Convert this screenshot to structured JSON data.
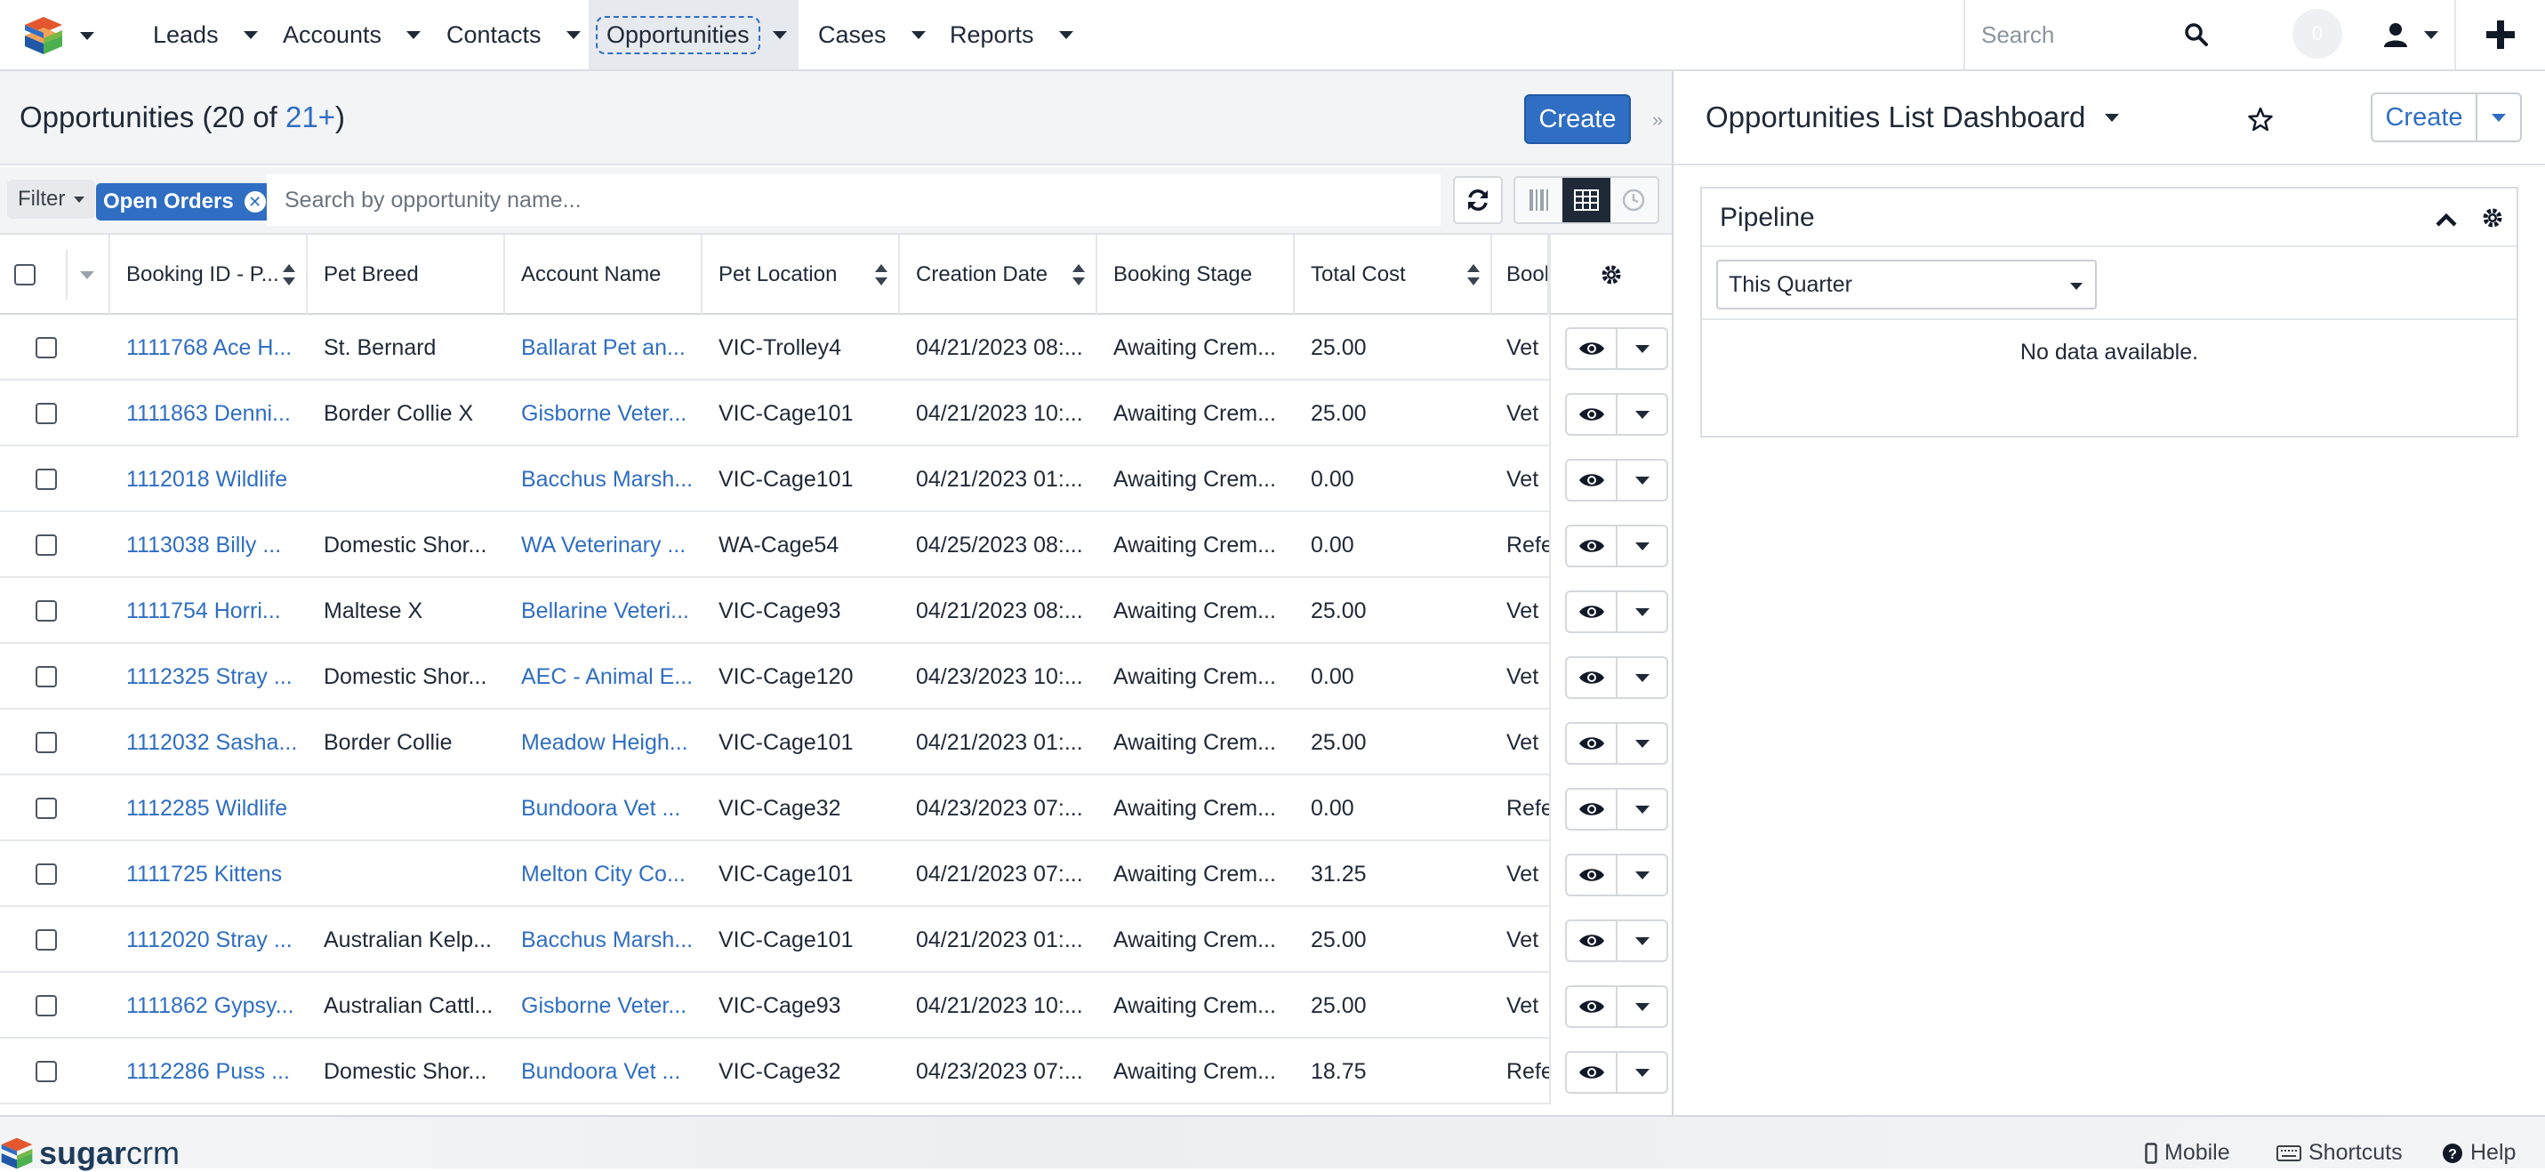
{
  "nav": {
    "items": [
      {
        "label": "Leads"
      },
      {
        "label": "Accounts"
      },
      {
        "label": "Contacts"
      },
      {
        "label": "Opportunities",
        "active": true
      },
      {
        "label": "Cases"
      },
      {
        "label": "Reports"
      }
    ],
    "search_placeholder": "Search",
    "notification_count": "0"
  },
  "list": {
    "title": "Opportunities",
    "count_prefix": "(20 of ",
    "count_total": "21+",
    "count_suffix": ")",
    "create_label": "Create",
    "filter_label": "Filter",
    "active_filter": "Open Orders",
    "search_placeholder": "Search by opportunity name...",
    "columns": [
      {
        "label": "Booking ID - P..."
      },
      {
        "label": "Pet Breed"
      },
      {
        "label": "Account Name"
      },
      {
        "label": "Pet Location"
      },
      {
        "label": "Creation Date"
      },
      {
        "label": "Booking Stage"
      },
      {
        "label": "Total Cost"
      },
      {
        "label": "Bool"
      }
    ],
    "rows": [
      {
        "id": "1111768 Ace H...",
        "breed": "St. Bernard",
        "account": "Ballarat Pet an...",
        "location": "VIC-Trolley4",
        "date": "04/21/2023 08:...",
        "stage": "Awaiting Crem...",
        "cost": "25.00",
        "extra": "Vet"
      },
      {
        "id": "1111863 Denni...",
        "breed": "Border Collie X",
        "account": "Gisborne Veter...",
        "location": "VIC-Cage101",
        "date": "04/21/2023 10:...",
        "stage": "Awaiting Crem...",
        "cost": "25.00",
        "extra": "Vet"
      },
      {
        "id": "1112018 Wildlife",
        "breed": "",
        "account": "Bacchus Marsh...",
        "location": "VIC-Cage101",
        "date": "04/21/2023 01:...",
        "stage": "Awaiting Crem...",
        "cost": "0.00",
        "extra": "Vet"
      },
      {
        "id": "1113038 Billy ...",
        "breed": "Domestic Shor...",
        "account": "WA Veterinary ...",
        "location": "WA-Cage54",
        "date": "04/25/2023 08:...",
        "stage": "Awaiting Crem...",
        "cost": "0.00",
        "extra": "Refe"
      },
      {
        "id": "1111754 Horri...",
        "breed": "Maltese X",
        "account": "Bellarine Veteri...",
        "location": "VIC-Cage93",
        "date": "04/21/2023 08:...",
        "stage": "Awaiting Crem...",
        "cost": "25.00",
        "extra": "Vet"
      },
      {
        "id": "1112325 Stray ...",
        "breed": "Domestic Shor...",
        "account": "AEC - Animal E...",
        "location": "VIC-Cage120",
        "date": "04/23/2023 10:...",
        "stage": "Awaiting Crem...",
        "cost": "0.00",
        "extra": "Vet"
      },
      {
        "id": "1112032 Sasha...",
        "breed": "Border Collie",
        "account": "Meadow Heigh...",
        "location": "VIC-Cage101",
        "date": "04/21/2023 01:...",
        "stage": "Awaiting Crem...",
        "cost": "25.00",
        "extra": "Vet"
      },
      {
        "id": "1112285 Wildlife",
        "breed": "",
        "account": "Bundoora Vet ...",
        "location": "VIC-Cage32",
        "date": "04/23/2023 07:...",
        "stage": "Awaiting Crem...",
        "cost": "0.00",
        "extra": "Refe"
      },
      {
        "id": "1111725 Kittens",
        "breed": "",
        "account": "Melton City Co...",
        "location": "VIC-Cage101",
        "date": "04/21/2023 07:...",
        "stage": "Awaiting Crem...",
        "cost": "31.25",
        "extra": "Vet"
      },
      {
        "id": "1112020 Stray ...",
        "breed": "Australian Kelp...",
        "account": "Bacchus Marsh...",
        "location": "VIC-Cage101",
        "date": "04/21/2023 01:...",
        "stage": "Awaiting Crem...",
        "cost": "25.00",
        "extra": "Vet"
      },
      {
        "id": "1111862 Gypsy...",
        "breed": "Australian Cattl...",
        "account": "Gisborne Veter...",
        "location": "VIC-Cage93",
        "date": "04/21/2023 10:...",
        "stage": "Awaiting Crem...",
        "cost": "25.00",
        "extra": "Vet"
      },
      {
        "id": "1112286 Puss ...",
        "breed": "Domestic Shor...",
        "account": "Bundoora Vet ...",
        "location": "VIC-Cage32",
        "date": "04/23/2023 07:...",
        "stage": "Awaiting Crem...",
        "cost": "18.75",
        "extra": "Refe"
      }
    ]
  },
  "dashboard": {
    "title": "Opportunities List Dashboard",
    "create_label": "Create",
    "dashlet": {
      "title": "Pipeline",
      "range_selected": "This Quarter",
      "empty_text": "No data available."
    }
  },
  "footer": {
    "brand_bold": "sugar",
    "brand_rest": "crm",
    "mobile": "Mobile",
    "shortcuts": "Shortcuts",
    "help": "Help"
  },
  "colors": {
    "accent": "#2f6ec2",
    "nav_active_bg": "#e6e9ee",
    "header_bg": "#f3f4f6"
  }
}
